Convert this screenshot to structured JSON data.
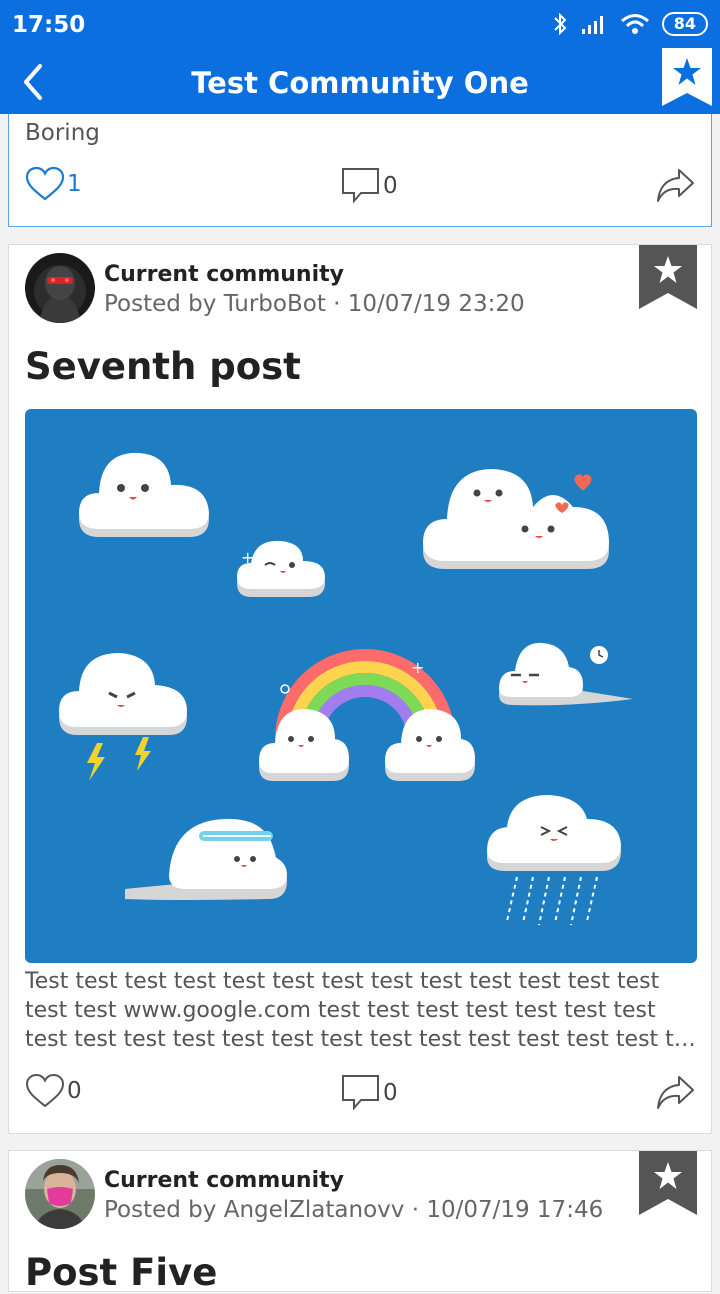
{
  "status_bar": {
    "time": "17:50",
    "battery": "84",
    "icons": [
      "bluetooth-icon",
      "signal-icon",
      "wifi-icon",
      "battery-icon"
    ]
  },
  "app_bar": {
    "title": "Test Community One",
    "back_icon": "chevron-left-icon",
    "favorite_icon": "bookmark-star-icon"
  },
  "posts": [
    {
      "text": "Boring",
      "likes": "1",
      "comments": "0",
      "liked": true
    },
    {
      "community": "Current community",
      "meta": "Posted by TurboBot · 10/07/19 23:20",
      "title": "Seventh post",
      "image": "weather-clouds-illustration",
      "body_line1": "Test test test test test test test test test test test test test",
      "body_line2": "test test www.google.com test test test test test test test",
      "body_line3": "test test test test test test test test test test test test test test test test",
      "likes": "0",
      "comments": "0"
    },
    {
      "community": "Current community",
      "meta": "Posted by AngelZlatanovv · 10/07/19 17:46",
      "title": "Post Five"
    }
  ],
  "colors": {
    "primary": "#0b6fe0",
    "image_bg": "#1f7dc1",
    "ribbon": "#555555"
  }
}
